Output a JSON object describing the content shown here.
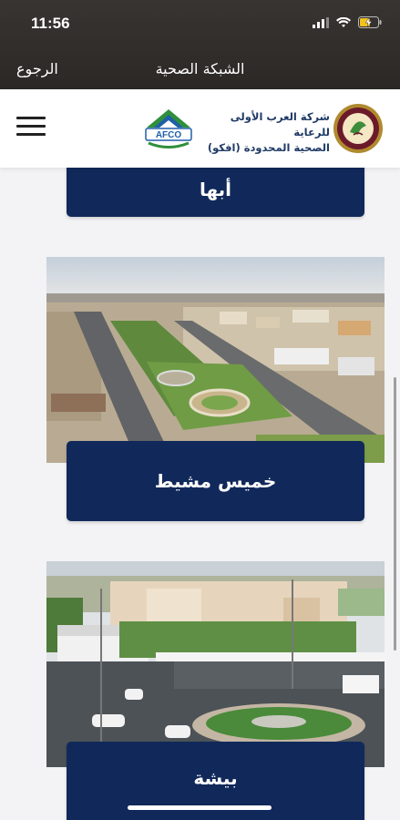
{
  "status_bar": {
    "time": "11:56"
  },
  "nav_bar": {
    "back_label": "الرجوع",
    "title": "الشبكة الصحية"
  },
  "header": {
    "company_name_line1": "شركة العرب الأولى للرعاية",
    "company_name_line2": "الصحية المحدودة (افكو)",
    "logo_text": "AFCO"
  },
  "cities": [
    {
      "label": "أبها"
    },
    {
      "label": "خميس مشيط"
    },
    {
      "label": "بيشة"
    }
  ],
  "colors": {
    "button_bg": "#11295a",
    "accent_green": "#2f8f3c",
    "accent_blue": "#1f5fa8"
  }
}
